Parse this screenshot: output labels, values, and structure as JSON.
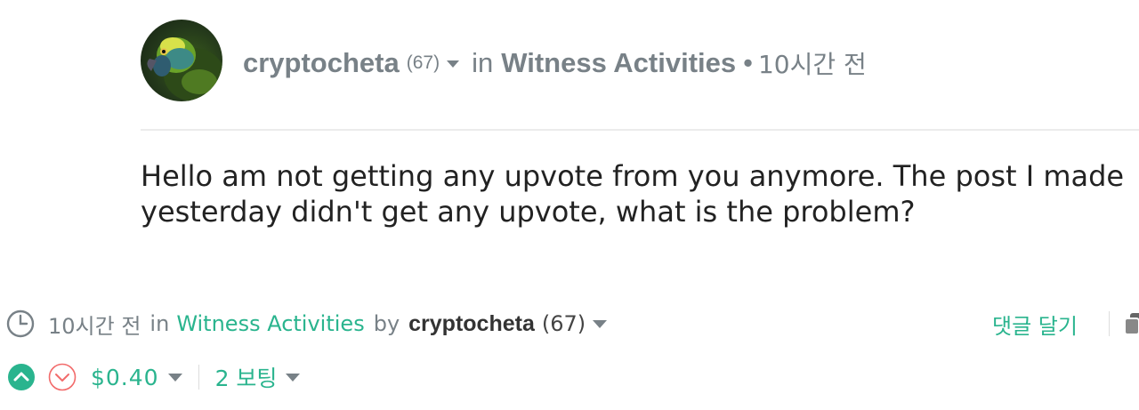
{
  "post": {
    "author": "cryptocheta",
    "reputation": "(67)",
    "in_label": "in",
    "category": "Witness Activities",
    "separator": "•",
    "time_ago": "10시간 전",
    "body_lines": [
      "Hello am not getting any upvote from you anymore. The post I made",
      "yesterday didn't get any upvote, what is the problem?"
    ]
  },
  "footer": {
    "time_ago": "10시간 전",
    "in_label": "in",
    "category": "Witness Activities",
    "by_label": "by",
    "author": "cryptocheta",
    "reputation": "(67)",
    "reply_label": "댓글 달기",
    "payout": "$0.40",
    "votes": "2 보팅"
  },
  "icons": {
    "avatar": "parrot-avatar",
    "clock": "clock-icon",
    "upvote": "upvote-icon",
    "downvote": "downvote-icon",
    "copy": "copy-icon",
    "dropdown": "caret-down-icon"
  },
  "colors": {
    "accent": "#2ab48e",
    "muted": "#788187",
    "downvote": "#f26b6b"
  }
}
